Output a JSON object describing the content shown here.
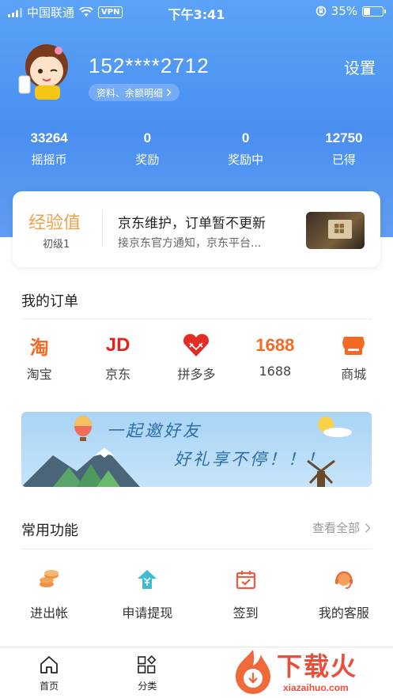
{
  "status_bar": {
    "carrier": "中国联通",
    "vpn": "VPN",
    "time": "下午3:41",
    "battery": "35%",
    "battery_level": 0.35
  },
  "profile": {
    "phone": "152****2712",
    "detail_link": "资料、余额明细",
    "settings": "设置"
  },
  "stats": [
    {
      "value": "33264",
      "label": "摇摇币"
    },
    {
      "value": "0",
      "label": "奖励"
    },
    {
      "value": "0",
      "label": "奖励中"
    },
    {
      "value": "12750",
      "label": "已得"
    }
  ],
  "experience": {
    "title": "经验值",
    "level": "初级1",
    "headline": "京东维护，订单暂不更新",
    "subtext": "接京东官方通知，京东平台..."
  },
  "orders": {
    "title": "我的订单",
    "items": [
      {
        "logo": "淘",
        "label": "淘宝"
      },
      {
        "logo": "JD",
        "label": "京东"
      },
      {
        "logo": "pinduoduo-logo",
        "label": "拼多多"
      },
      {
        "logo": "1688",
        "label": "1688"
      },
      {
        "logo": "store-icon",
        "label": "商城"
      }
    ]
  },
  "banner": {
    "line1": "一起邀好友",
    "line2": "好礼享不停！！！"
  },
  "functions": {
    "title": "常用功能",
    "view_all": "查看全部",
    "items": [
      {
        "icon": "coins-icon",
        "label": "进出帐"
      },
      {
        "icon": "withdraw-icon",
        "label": "申请提现"
      },
      {
        "icon": "calendar-check-icon",
        "label": "签到"
      },
      {
        "icon": "headset-icon",
        "label": "我的客服"
      }
    ]
  },
  "tabbar": [
    {
      "icon": "home-icon",
      "label": "首页"
    },
    {
      "icon": "category-icon",
      "label": "分类"
    }
  ],
  "watermark": {
    "text": "下载火",
    "url": "xiazaihuo.com"
  },
  "colors": {
    "header_blue": "#4a8ff0",
    "accent_orange": "#f26a23",
    "jd_red": "#e1251b",
    "exp_orange": "#f0a14d"
  }
}
